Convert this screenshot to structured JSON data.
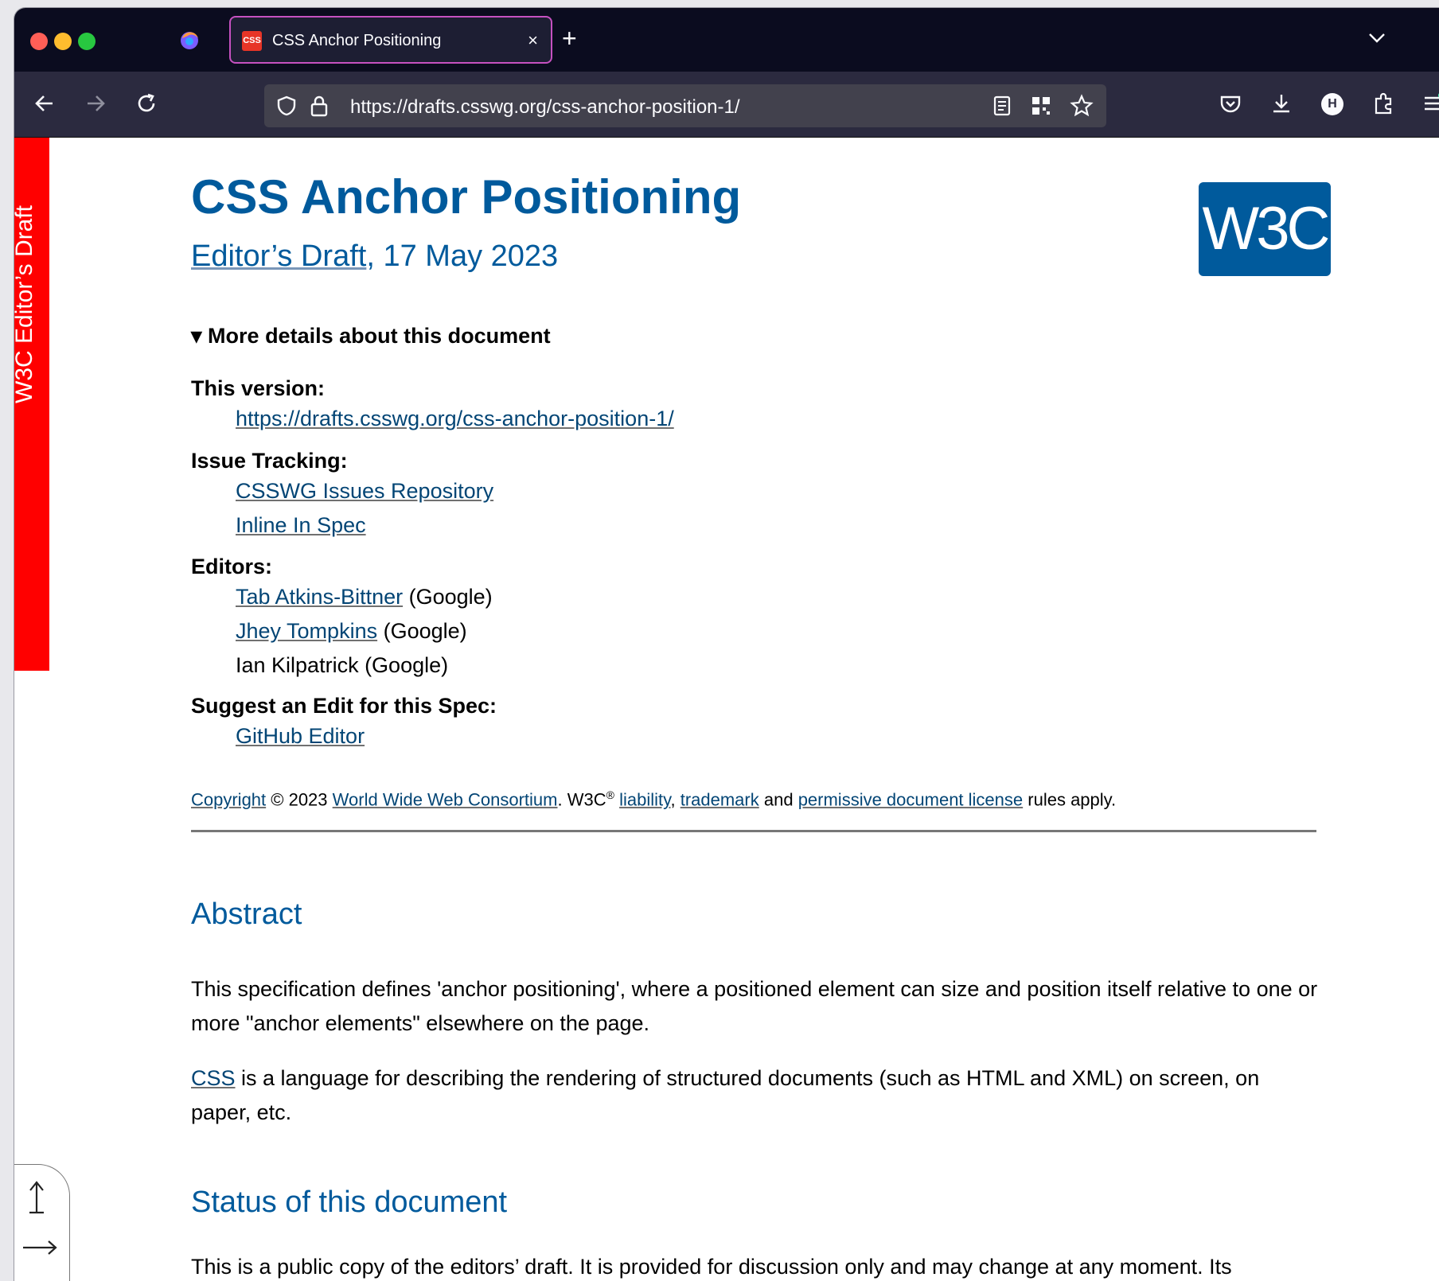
{
  "browser": {
    "tab_title": "CSS Anchor Positioning",
    "tab_favicon_text": "CSS",
    "tab_close": "×",
    "new_tab": "+",
    "url": "https://drafts.csswg.org/css-anchor-position-1/",
    "profile_initial": "H"
  },
  "ribbon": {
    "label": "W3C Editor’s Draft"
  },
  "doc": {
    "title": "CSS Anchor Positioning",
    "subtitle_link": "Editor’s Draft",
    "subtitle_rest": ", 17 May 2023",
    "logo_text": "W3C",
    "details_summary": "▾ More details about this document",
    "this_version_label": "This version:",
    "this_version_url": "https://drafts.csswg.org/css-anchor-position-1/",
    "issue_tracking_label": "Issue Tracking:",
    "issue_links": [
      "CSSWG Issues Repository",
      "Inline In Spec"
    ],
    "editors_label": "Editors:",
    "editors": [
      {
        "name": "Tab Atkins-Bittner",
        "org": " (Google)"
      },
      {
        "name": "Jhey Tompkins",
        "org": " (Google)"
      },
      {
        "name": "Ian Kilpatrick (Google)"
      }
    ],
    "suggest_label": "Suggest an Edit for this Spec:",
    "suggest_link": "GitHub Editor",
    "copyright": {
      "copyright_link": "Copyright",
      "text1": " © 2023 ",
      "consortium_link": "World Wide Web Consortium",
      "text2": ". W3C",
      "reg": "®",
      "liability_link": "liability",
      "comma": ", ",
      "trademark_link": "trademark",
      "and": " and ",
      "license_link": "permissive document license",
      "tail": " rules apply."
    },
    "abstract_heading": "Abstract",
    "abstract_p1": "This specification defines 'anchor positioning', where a positioned element can size and position itself relative to one or more \"anchor elements\" elsewhere on the page.",
    "abstract_p2_link": "CSS",
    "abstract_p2_rest": " is a language for describing the rendering of structured documents (such as HTML and XML) on screen, on paper, etc.",
    "status_heading": "Status of this document",
    "status_p": "This is a public copy of the editors’ draft. It is provided for discussion only and may change at any moment. Its"
  },
  "colors": {
    "brand_blue": "#005a9c",
    "ribbon_red": "#ff0000",
    "tab_highlight": "#c651c1"
  }
}
